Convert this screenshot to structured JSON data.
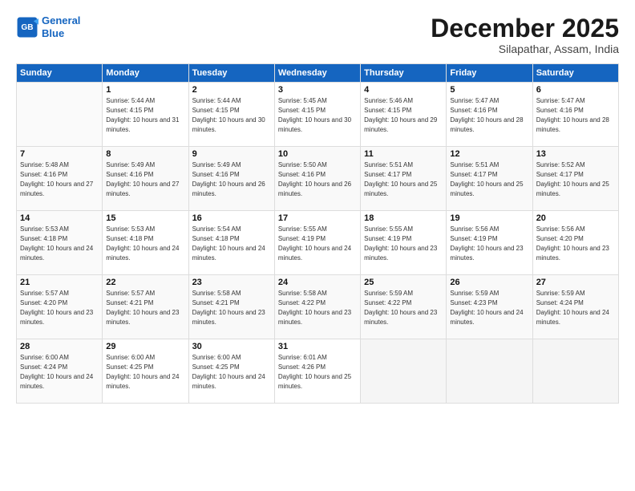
{
  "logo": {
    "line1": "General",
    "line2": "Blue"
  },
  "title": "December 2025",
  "subtitle": "Silapathar, Assam, India",
  "days_of_week": [
    "Sunday",
    "Monday",
    "Tuesday",
    "Wednesday",
    "Thursday",
    "Friday",
    "Saturday"
  ],
  "weeks": [
    [
      {
        "day": "",
        "sunrise": "",
        "sunset": "",
        "daylight": ""
      },
      {
        "day": "1",
        "sunrise": "Sunrise: 5:44 AM",
        "sunset": "Sunset: 4:15 PM",
        "daylight": "Daylight: 10 hours and 31 minutes."
      },
      {
        "day": "2",
        "sunrise": "Sunrise: 5:44 AM",
        "sunset": "Sunset: 4:15 PM",
        "daylight": "Daylight: 10 hours and 30 minutes."
      },
      {
        "day": "3",
        "sunrise": "Sunrise: 5:45 AM",
        "sunset": "Sunset: 4:15 PM",
        "daylight": "Daylight: 10 hours and 30 minutes."
      },
      {
        "day": "4",
        "sunrise": "Sunrise: 5:46 AM",
        "sunset": "Sunset: 4:15 PM",
        "daylight": "Daylight: 10 hours and 29 minutes."
      },
      {
        "day": "5",
        "sunrise": "Sunrise: 5:47 AM",
        "sunset": "Sunset: 4:16 PM",
        "daylight": "Daylight: 10 hours and 28 minutes."
      },
      {
        "day": "6",
        "sunrise": "Sunrise: 5:47 AM",
        "sunset": "Sunset: 4:16 PM",
        "daylight": "Daylight: 10 hours and 28 minutes."
      }
    ],
    [
      {
        "day": "7",
        "sunrise": "Sunrise: 5:48 AM",
        "sunset": "Sunset: 4:16 PM",
        "daylight": "Daylight: 10 hours and 27 minutes."
      },
      {
        "day": "8",
        "sunrise": "Sunrise: 5:49 AM",
        "sunset": "Sunset: 4:16 PM",
        "daylight": "Daylight: 10 hours and 27 minutes."
      },
      {
        "day": "9",
        "sunrise": "Sunrise: 5:49 AM",
        "sunset": "Sunset: 4:16 PM",
        "daylight": "Daylight: 10 hours and 26 minutes."
      },
      {
        "day": "10",
        "sunrise": "Sunrise: 5:50 AM",
        "sunset": "Sunset: 4:16 PM",
        "daylight": "Daylight: 10 hours and 26 minutes."
      },
      {
        "day": "11",
        "sunrise": "Sunrise: 5:51 AM",
        "sunset": "Sunset: 4:17 PM",
        "daylight": "Daylight: 10 hours and 25 minutes."
      },
      {
        "day": "12",
        "sunrise": "Sunrise: 5:51 AM",
        "sunset": "Sunset: 4:17 PM",
        "daylight": "Daylight: 10 hours and 25 minutes."
      },
      {
        "day": "13",
        "sunrise": "Sunrise: 5:52 AM",
        "sunset": "Sunset: 4:17 PM",
        "daylight": "Daylight: 10 hours and 25 minutes."
      }
    ],
    [
      {
        "day": "14",
        "sunrise": "Sunrise: 5:53 AM",
        "sunset": "Sunset: 4:18 PM",
        "daylight": "Daylight: 10 hours and 24 minutes."
      },
      {
        "day": "15",
        "sunrise": "Sunrise: 5:53 AM",
        "sunset": "Sunset: 4:18 PM",
        "daylight": "Daylight: 10 hours and 24 minutes."
      },
      {
        "day": "16",
        "sunrise": "Sunrise: 5:54 AM",
        "sunset": "Sunset: 4:18 PM",
        "daylight": "Daylight: 10 hours and 24 minutes."
      },
      {
        "day": "17",
        "sunrise": "Sunrise: 5:55 AM",
        "sunset": "Sunset: 4:19 PM",
        "daylight": "Daylight: 10 hours and 24 minutes."
      },
      {
        "day": "18",
        "sunrise": "Sunrise: 5:55 AM",
        "sunset": "Sunset: 4:19 PM",
        "daylight": "Daylight: 10 hours and 23 minutes."
      },
      {
        "day": "19",
        "sunrise": "Sunrise: 5:56 AM",
        "sunset": "Sunset: 4:19 PM",
        "daylight": "Daylight: 10 hours and 23 minutes."
      },
      {
        "day": "20",
        "sunrise": "Sunrise: 5:56 AM",
        "sunset": "Sunset: 4:20 PM",
        "daylight": "Daylight: 10 hours and 23 minutes."
      }
    ],
    [
      {
        "day": "21",
        "sunrise": "Sunrise: 5:57 AM",
        "sunset": "Sunset: 4:20 PM",
        "daylight": "Daylight: 10 hours and 23 minutes."
      },
      {
        "day": "22",
        "sunrise": "Sunrise: 5:57 AM",
        "sunset": "Sunset: 4:21 PM",
        "daylight": "Daylight: 10 hours and 23 minutes."
      },
      {
        "day": "23",
        "sunrise": "Sunrise: 5:58 AM",
        "sunset": "Sunset: 4:21 PM",
        "daylight": "Daylight: 10 hours and 23 minutes."
      },
      {
        "day": "24",
        "sunrise": "Sunrise: 5:58 AM",
        "sunset": "Sunset: 4:22 PM",
        "daylight": "Daylight: 10 hours and 23 minutes."
      },
      {
        "day": "25",
        "sunrise": "Sunrise: 5:59 AM",
        "sunset": "Sunset: 4:22 PM",
        "daylight": "Daylight: 10 hours and 23 minutes."
      },
      {
        "day": "26",
        "sunrise": "Sunrise: 5:59 AM",
        "sunset": "Sunset: 4:23 PM",
        "daylight": "Daylight: 10 hours and 24 minutes."
      },
      {
        "day": "27",
        "sunrise": "Sunrise: 5:59 AM",
        "sunset": "Sunset: 4:24 PM",
        "daylight": "Daylight: 10 hours and 24 minutes."
      }
    ],
    [
      {
        "day": "28",
        "sunrise": "Sunrise: 6:00 AM",
        "sunset": "Sunset: 4:24 PM",
        "daylight": "Daylight: 10 hours and 24 minutes."
      },
      {
        "day": "29",
        "sunrise": "Sunrise: 6:00 AM",
        "sunset": "Sunset: 4:25 PM",
        "daylight": "Daylight: 10 hours and 24 minutes."
      },
      {
        "day": "30",
        "sunrise": "Sunrise: 6:00 AM",
        "sunset": "Sunset: 4:25 PM",
        "daylight": "Daylight: 10 hours and 24 minutes."
      },
      {
        "day": "31",
        "sunrise": "Sunrise: 6:01 AM",
        "sunset": "Sunset: 4:26 PM",
        "daylight": "Daylight: 10 hours and 25 minutes."
      },
      {
        "day": "",
        "sunrise": "",
        "sunset": "",
        "daylight": ""
      },
      {
        "day": "",
        "sunrise": "",
        "sunset": "",
        "daylight": ""
      },
      {
        "day": "",
        "sunrise": "",
        "sunset": "",
        "daylight": ""
      }
    ]
  ]
}
